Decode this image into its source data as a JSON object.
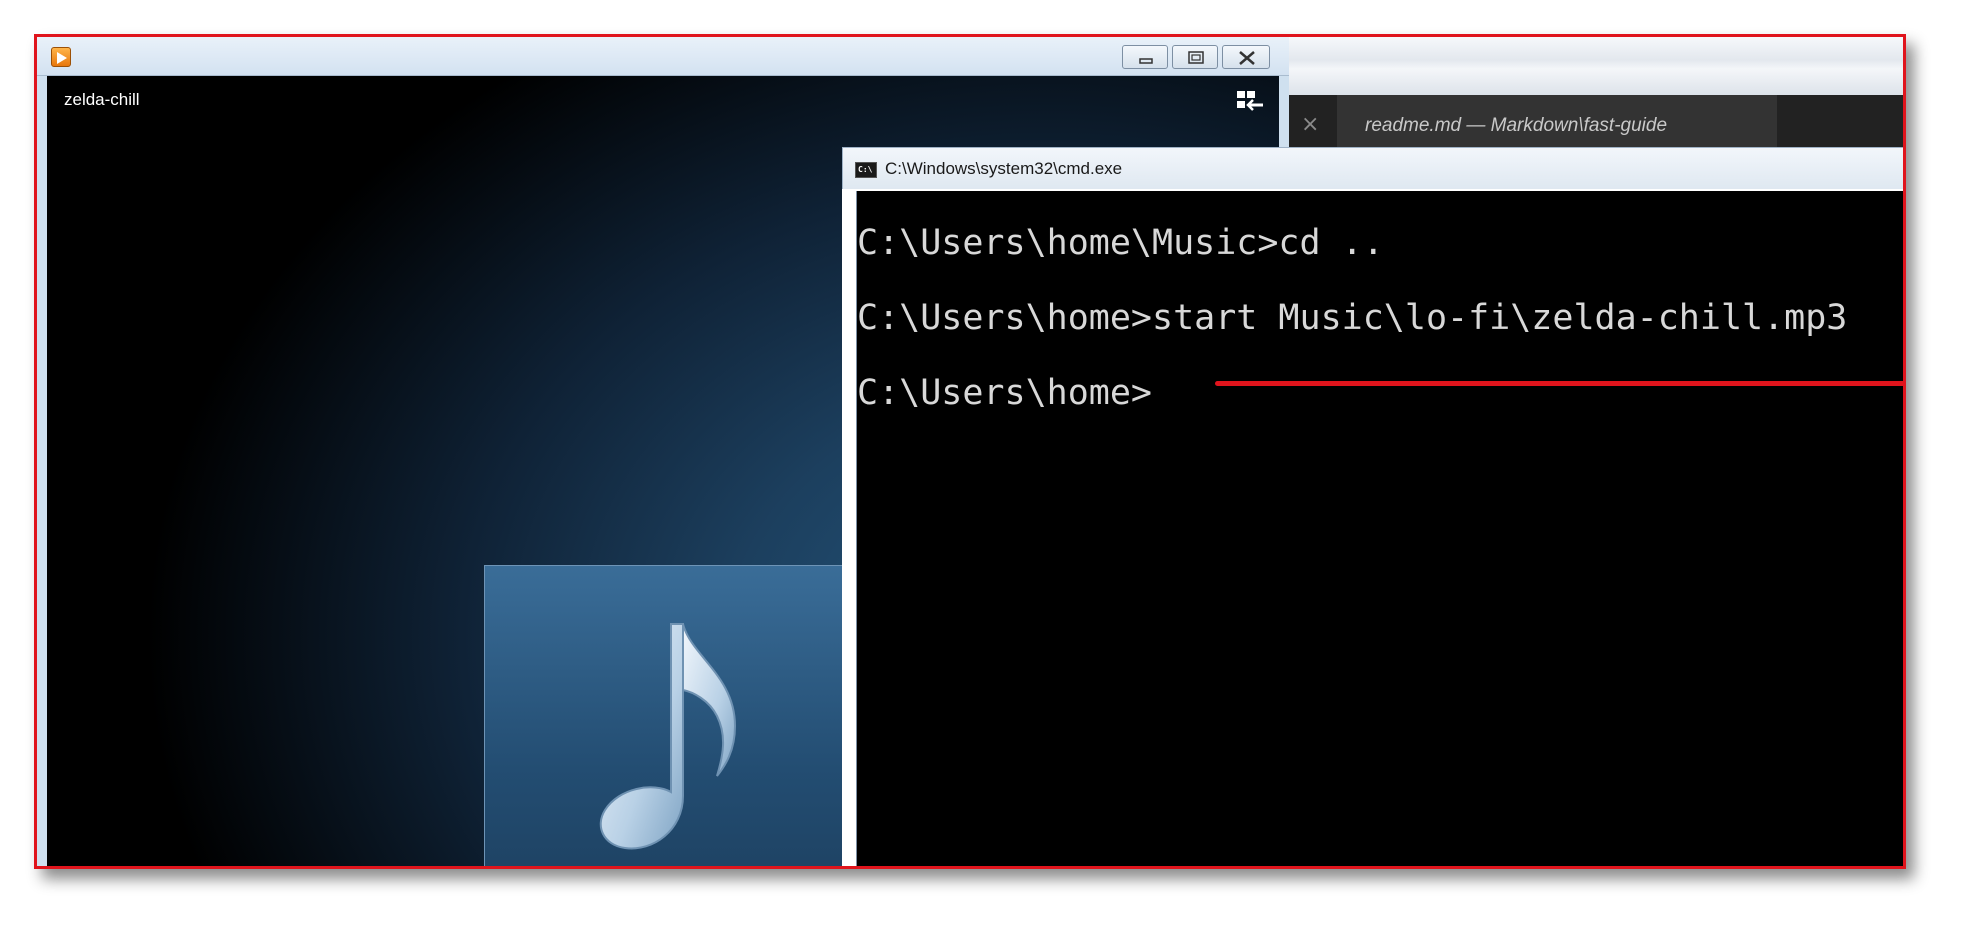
{
  "media_player": {
    "track_title": "zelda-chill",
    "app_icon": "media-player-icon",
    "switch_view_icon": "switch-to-library-icon",
    "album_art_icon": "music-note-icon"
  },
  "editor": {
    "tab_label": "readme.md — Markdown\\fast-guide",
    "tab_close_glyph": "×"
  },
  "cmd": {
    "title": "C:\\Windows\\system32\\cmd.exe",
    "icon_text": "C:\\",
    "lines": [
      "C:\\Users\\home\\Music>cd ..",
      "C:\\Users\\home>start Music\\lo-fi\\zelda-chill.mp3",
      "C:\\Users\\home>"
    ]
  },
  "annotation": {
    "highlight_color": "#e0141c",
    "highlighted_command": "start Music\\lo-fi\\zelda-chill.mp3"
  }
}
